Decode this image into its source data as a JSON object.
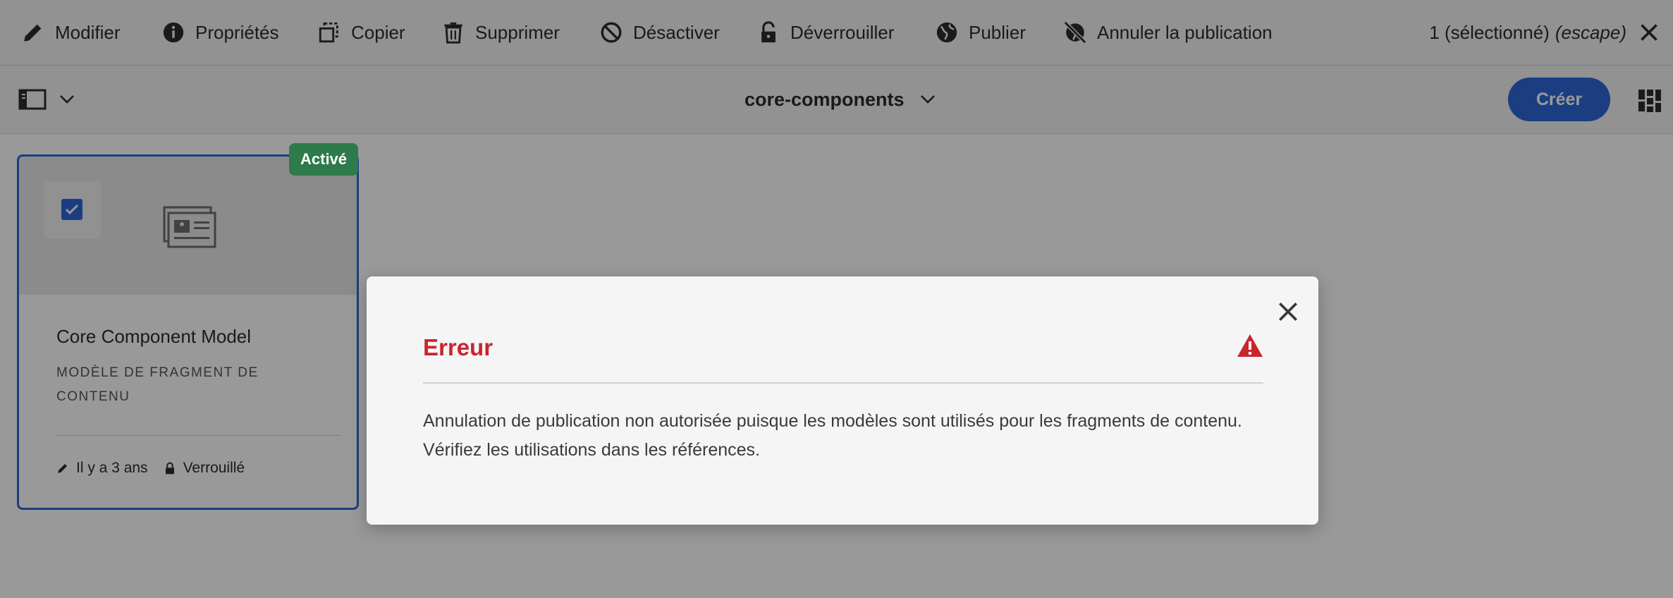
{
  "actionbar": {
    "actions": [
      {
        "label": "Modifier",
        "icon": "pencil-icon"
      },
      {
        "label": "Propriétés",
        "icon": "info-icon"
      },
      {
        "label": "Copier",
        "icon": "copy-icon"
      },
      {
        "label": "Supprimer",
        "icon": "trash-icon"
      },
      {
        "label": "Désactiver",
        "icon": "disable-icon"
      },
      {
        "label": "Déverrouiller",
        "icon": "unlock-icon"
      },
      {
        "label": "Publier",
        "icon": "globe-icon"
      },
      {
        "label": "Annuler la publication",
        "icon": "globe-off-icon"
      }
    ],
    "selection_count": "1 (sélectionné)",
    "selection_hint": "(escape)"
  },
  "toolbar": {
    "breadcrumb": "core-components",
    "create_label": "Créer"
  },
  "card": {
    "badge": "Activé",
    "title": "Core Component Model",
    "type": "MODÈLE DE FRAGMENT DE CONTENU",
    "modified": "Il y a 3 ans",
    "lock_status": "Verrouillé"
  },
  "dialog": {
    "title": "Erreur",
    "line1": "Annulation de publication non autorisée puisque les modèles sont utilisés pour les fragments de contenu.",
    "line2": "Vérifiez les utilisations dans les références."
  },
  "colors": {
    "accent": "#2c68d8",
    "error": "#c9252d",
    "badge": "#2d7a4a"
  }
}
